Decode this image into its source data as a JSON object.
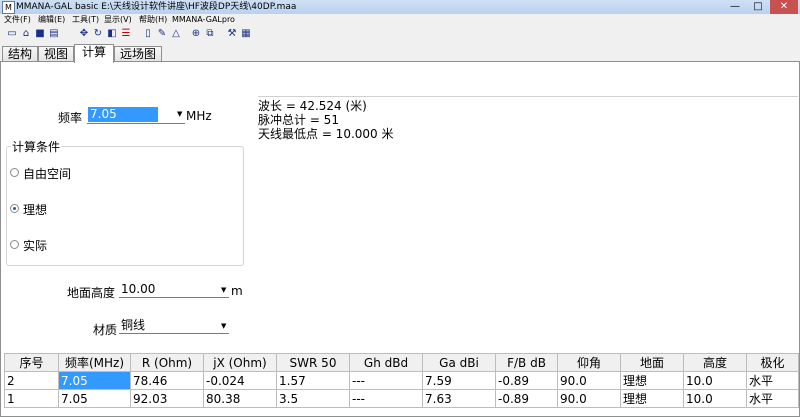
{
  "window": {
    "title": "MMANA-GAL basic E:\\天线设计软件讲座\\HF波段DP天线\\40DP.maa",
    "controls": [
      "—",
      "□",
      "✕"
    ]
  },
  "menu": [
    "文件(F)",
    "编辑(E)",
    "工具(T)",
    "显示(V)",
    "帮助(H)",
    "MMANA-GALpro"
  ],
  "tabs": [
    "结构",
    "视图",
    "计算",
    "远场图"
  ],
  "calc": {
    "freq_label": "频率",
    "freq_value": "7.05",
    "freq_unit": "MHz",
    "info": [
      "波长 = 42.524 (米)",
      "脉冲总计 = 51",
      "天线最低点 = 10.000 米"
    ],
    "condition_title": "计算条件",
    "conditions": [
      {
        "label": "自由空间",
        "selected": false
      },
      {
        "label": "理想",
        "selected": true
      },
      {
        "label": "实际",
        "selected": false
      }
    ],
    "height_label": "地面高度",
    "height_value": "10.00",
    "height_unit": "m",
    "material_label": "材质",
    "material_value": "铜线"
  },
  "results": {
    "headers": [
      "序号",
      "频率(MHz)",
      "R (Ohm)",
      "jX (Ohm)",
      "SWR 50",
      "Gh dBd",
      "Ga dBi",
      "F/B dB",
      "仰角",
      "地面",
      "高度",
      "极化"
    ],
    "rows": [
      [
        "2",
        "7.05",
        "78.46",
        "-0.024",
        "1.57",
        "---",
        "7.59",
        "-0.89",
        "90.0",
        "理想",
        "10.0",
        "水平"
      ],
      [
        "1",
        "7.05",
        "92.03",
        "80.38",
        "3.5",
        "---",
        "7.63",
        "-0.89",
        "90.0",
        "理想",
        "10.0",
        "水平"
      ]
    ]
  }
}
